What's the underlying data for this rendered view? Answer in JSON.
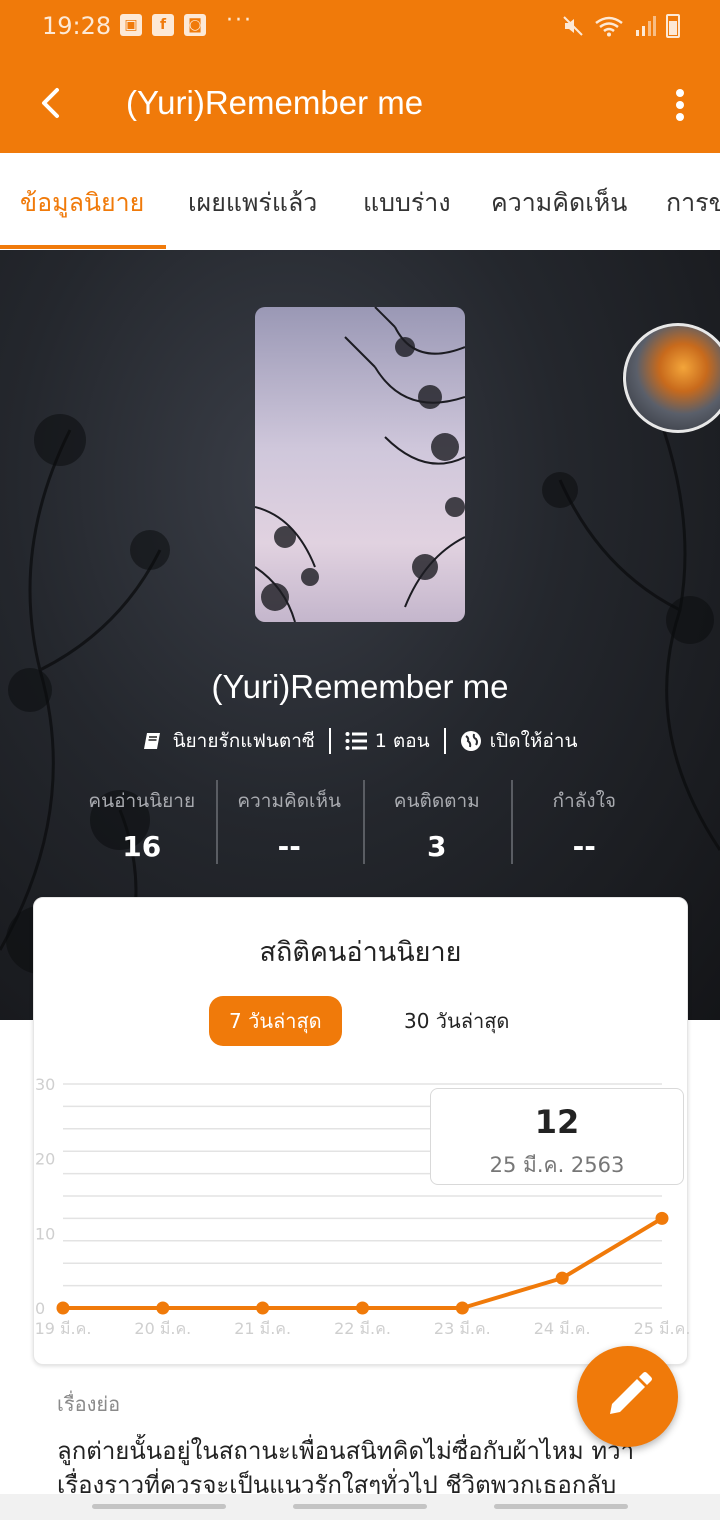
{
  "status_bar": {
    "time": "19:28",
    "left_icons": [
      "gallery-icon",
      "facebook-icon",
      "app-notification-icon"
    ],
    "overflow": "···",
    "right_icons": [
      "mute-icon",
      "wifi-icon",
      "signal-icon",
      "battery-icon"
    ]
  },
  "app_bar": {
    "title": "(Yuri)Remember me",
    "back_icon": "chevron-left-icon",
    "more_icon": "more-vertical-icon"
  },
  "tabs": [
    {
      "label": "ข้อมูลนิยาย",
      "active": true
    },
    {
      "label": "เผยแพร่แล้ว",
      "active": false
    },
    {
      "label": "แบบร่าง",
      "active": false
    },
    {
      "label": "ความคิดเห็น",
      "active": false
    },
    {
      "label": "การข",
      "active": false
    }
  ],
  "novel": {
    "title": "(Yuri)Remember me",
    "meta": [
      {
        "icon": "book-icon",
        "text": "นิยายรักแฟนตาซี"
      },
      {
        "icon": "list-icon",
        "text": "1 ตอน"
      },
      {
        "icon": "globe-icon",
        "text": "เปิดให้อ่าน"
      }
    ],
    "stats": [
      {
        "label": "คนอ่านนิยาย",
        "value": "16"
      },
      {
        "label": "ความคิดเห็น",
        "value": "--"
      },
      {
        "label": "คนติดตาม",
        "value": "3"
      },
      {
        "label": "กำลังใจ",
        "value": "--"
      }
    ]
  },
  "stats_card": {
    "title": "สถิติคนอ่านนิยาย",
    "range_buttons": [
      {
        "label": "7 วันล่าสุด",
        "active": true
      },
      {
        "label": "30 วันล่าสุด",
        "active": false
      }
    ],
    "tooltip": {
      "value": "12",
      "date": "25 มี.ค. 2563"
    }
  },
  "chart_data": {
    "type": "line",
    "x": [
      "19 มี.ค.",
      "20 มี.ค.",
      "21 มี.ค.",
      "22 มี.ค.",
      "23 มี.ค.",
      "24 มี.ค.",
      "25 มี.ค."
    ],
    "series": [
      {
        "values": [
          0,
          0,
          0,
          0,
          0,
          4,
          12
        ]
      }
    ],
    "y_ticks": [
      "0",
      "10",
      "20",
      "30"
    ],
    "ylim": [
      0,
      30
    ],
    "grid": true,
    "color": "#f07a0a"
  },
  "synopsis": {
    "label": "เรื่องย่อ",
    "text_lines": [
      "ลูกต่ายนั้นอยู่ในสถานะเพื่อนสนิทคิดไม่ซื่อกับผ้าไหม ทว่า",
      "เรื่องราวที่ควรจะเป็นแนวรักใสๆทั่วไป ชีวิตพวกเธอกลับ"
    ]
  },
  "fab_icon": "pencil-icon",
  "colors": {
    "accent": "#f07a0a",
    "hero_bg": "#24272d"
  }
}
